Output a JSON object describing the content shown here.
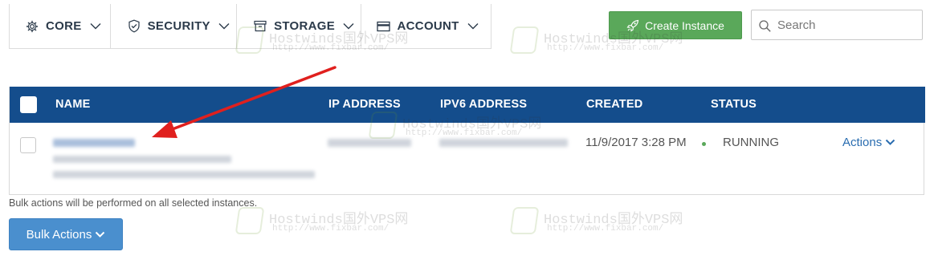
{
  "nav": {
    "tabs": [
      {
        "label": "CORE",
        "icon": "gear-icon"
      },
      {
        "label": "SECURITY",
        "icon": "shield-icon"
      },
      {
        "label": "STORAGE",
        "icon": "archive-box-icon"
      },
      {
        "label": "ACCOUNT",
        "icon": "card-icon"
      }
    ]
  },
  "toolbar": {
    "create_label": "Create Instance",
    "search_placeholder": "Search"
  },
  "table": {
    "columns": [
      "NAME",
      "IP ADDRESS",
      "IPV6 ADDRESS",
      "CREATED",
      "STATUS"
    ],
    "rows": [
      {
        "created": "11/9/2017 3:28 PM",
        "status": "RUNNING",
        "actions_label": "Actions"
      }
    ]
  },
  "bulk": {
    "note": "Bulk actions will be performed on all selected instances.",
    "button_label": "Bulk Actions"
  },
  "watermark": {
    "line1": "Hostwinds国外VPS网",
    "line2": "http://www.fixbar.com/"
  },
  "colors": {
    "header_bg": "#144d8c",
    "create_btn": "#5aa85a",
    "bulk_btn": "#4a8fce",
    "annotation_arrow": "#e0201e",
    "status_running": "#5aa85a"
  }
}
